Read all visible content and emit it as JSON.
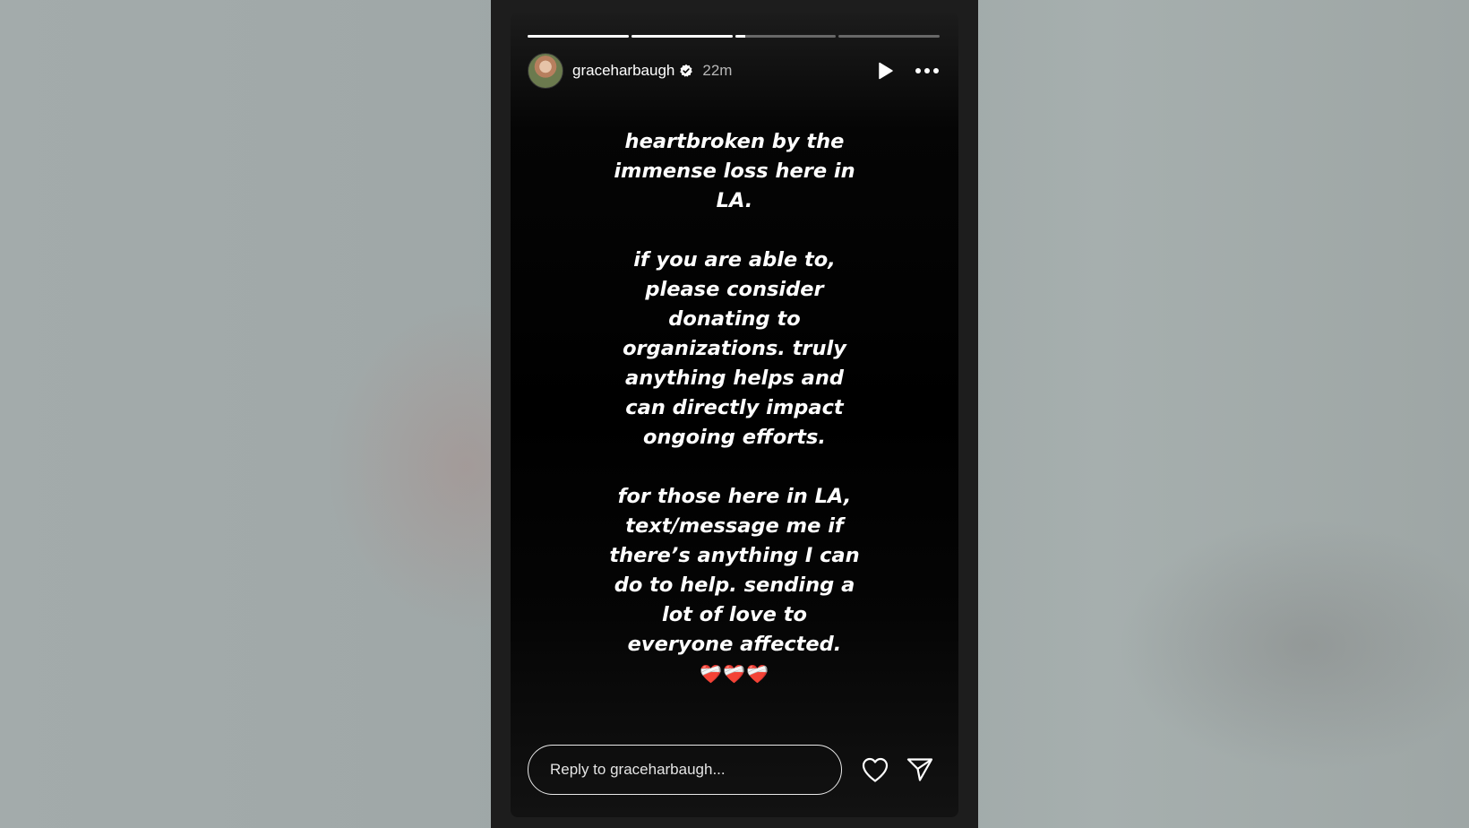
{
  "story": {
    "progress": [
      1.0,
      1.0,
      0.1,
      0.0
    ],
    "user": {
      "username": "graceharbaugh",
      "verified": true,
      "time_ago": "22m",
      "avatar_icon": "avatar-photo"
    },
    "controls": {
      "play_icon": "play-icon",
      "more_icon": "more-options-icon"
    },
    "message": {
      "paragraph_1": "heartbroken by the immense loss here in LA.",
      "paragraph_2": "if you are able to, please consider donating to organizations. truly anything helps and can directly impact ongoing efforts.",
      "paragraph_3": "for those here in LA, text/message me if there’s anything I can do to help. sending a lot of love to everyone affected.",
      "emoji": "❤️‍🩹❤️‍🩹❤️‍🩹"
    },
    "footer": {
      "reply_placeholder": "Reply to graceharbaugh...",
      "like_icon": "heart-icon",
      "share_icon": "send-icon"
    }
  }
}
